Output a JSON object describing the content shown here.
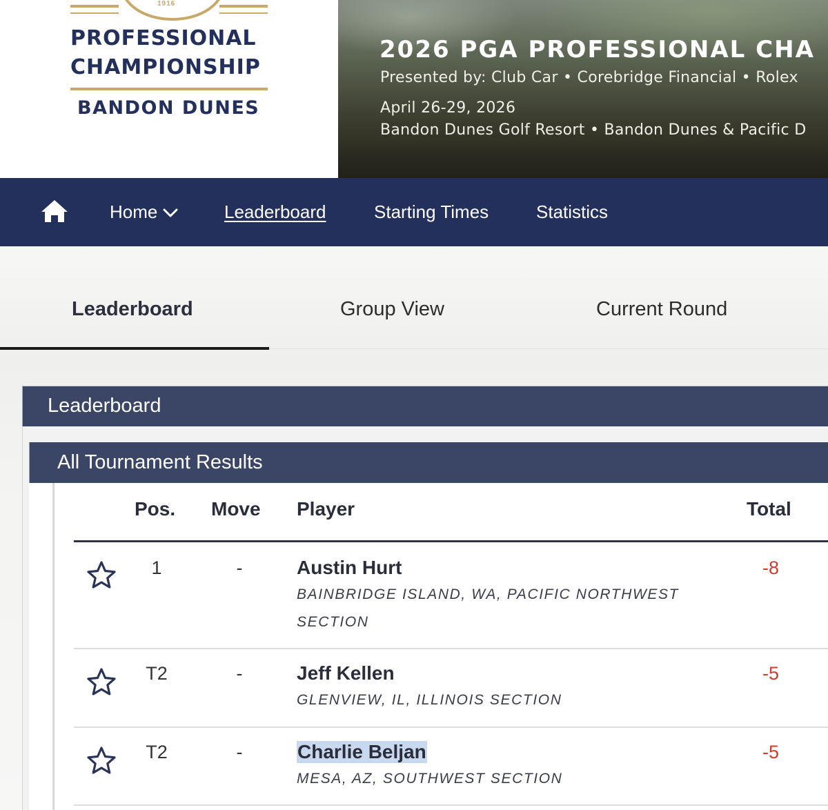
{
  "logo": {
    "year": "1916",
    "line1": "PROFESSIONAL",
    "line2": "CHAMPIONSHIP",
    "line3": "BANDON DUNES"
  },
  "banner": {
    "title": "2026 PGA PROFESSIONAL CHA",
    "presented_by": "Presented by: Club Car • Corebridge Financial • Rolex",
    "dates": "April 26-29, 2026",
    "venue": "Bandon Dunes Golf Resort • Bandon Dunes & Pacific D"
  },
  "nav": {
    "items": [
      "Home",
      "Leaderboard",
      "Starting Times",
      "Statistics"
    ]
  },
  "tabs": [
    "Leaderboard",
    "Group View",
    "Current Round"
  ],
  "panel_title": "Leaderboard",
  "sub_title": "All Tournament Results",
  "table": {
    "headers": {
      "pos": "Pos.",
      "move": "Move",
      "player": "Player",
      "total": "Total"
    },
    "rows": [
      {
        "pos": "1",
        "move": "-",
        "name": "Austin Hurt",
        "location": "BAINBRIDGE ISLAND, WA, PACIFIC NORTHWEST SECTION",
        "total": "-8"
      },
      {
        "pos": "T2",
        "move": "-",
        "name": "Jeff Kellen",
        "location": "GLENVIEW, IL, ILLINOIS SECTION",
        "total": "-5"
      },
      {
        "pos": "T2",
        "move": "-",
        "name": "Charlie Beljan",
        "location": "MESA, AZ, SOUTHWEST SECTION",
        "total": "-5",
        "highlighted": true
      }
    ]
  },
  "colors": {
    "navy": "#24305c",
    "panel": "#3b4566",
    "gold": "#c8a96a",
    "score_red": "#d63a2a",
    "highlight": "#c7d8ef"
  }
}
